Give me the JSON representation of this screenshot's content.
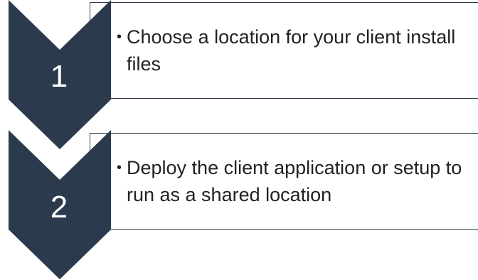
{
  "colors": {
    "chevron_fill": "#2b3b4d",
    "box_border": "#2f3d4d",
    "text": "#222222",
    "number": "#ffffff"
  },
  "steps": [
    {
      "number": "1",
      "bullet": "•",
      "text": "Choose a location for your client install files"
    },
    {
      "number": "2",
      "bullet": "•",
      "text": "Deploy the client application or setup to run as a shared location"
    }
  ]
}
